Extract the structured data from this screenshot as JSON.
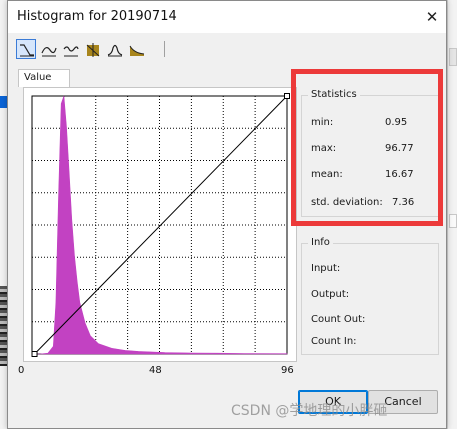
{
  "dialog": {
    "title": "Histogram for 20190714",
    "close_glyph": "✕"
  },
  "toolbar": {
    "buttons": [
      {
        "icon": "linear-stretch-icon",
        "active": true
      },
      {
        "icon": "curve-icon",
        "active": false
      },
      {
        "icon": "wave-curve-icon",
        "active": false
      },
      {
        "icon": "histogram-equalize-icon",
        "active": false
      },
      {
        "icon": "gaussian-icon",
        "active": false
      },
      {
        "icon": "square-root-icon",
        "active": false
      }
    ]
  },
  "tab": {
    "label": "Value"
  },
  "chart_data": {
    "type": "area",
    "color": "#c242c2",
    "xlim": [
      0,
      96
    ],
    "x_tick_labels": [
      "0",
      "48",
      "96"
    ],
    "grid": true,
    "x": [
      0.95,
      3,
      6,
      8,
      9,
      10,
      11,
      12,
      13,
      14,
      15,
      16,
      17,
      18,
      20,
      22,
      25,
      30,
      35,
      40,
      50,
      60,
      70,
      80,
      96
    ],
    "y": [
      0,
      0,
      0.3,
      3,
      20,
      62,
      97,
      100,
      88,
      70,
      52,
      38,
      28,
      20,
      12,
      7,
      4,
      2.2,
      1.4,
      1,
      0.6,
      0.4,
      0.3,
      0.2,
      0.1
    ],
    "stretch_line": [
      [
        0.95,
        0
      ],
      [
        96,
        100
      ]
    ]
  },
  "statistics": {
    "title": "Statistics",
    "rows": [
      {
        "label": "min:",
        "value": "0.95"
      },
      {
        "label": "max:",
        "value": "96.77"
      },
      {
        "label": "mean:",
        "value": "16.67"
      },
      {
        "label": "std. deviation:",
        "value": "7.36"
      }
    ],
    "highlight_color": "#ec3a3a"
  },
  "info": {
    "title": "Info",
    "labels": [
      "Input:",
      "Output:",
      "Count Out:",
      "Count In:"
    ]
  },
  "buttons": {
    "ok": "OK",
    "cancel": "Cancel"
  },
  "watermark": "CSDN @学地理的小胖砸"
}
